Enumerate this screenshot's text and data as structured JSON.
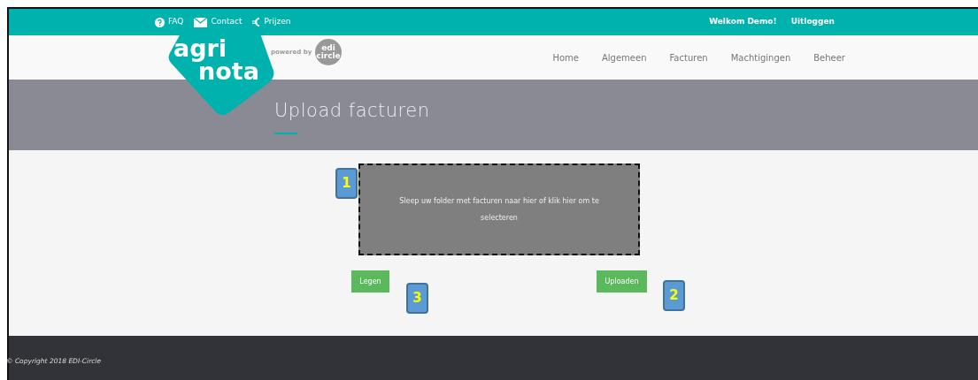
{
  "top_bar": {
    "links": [
      {
        "label": "FAQ"
      },
      {
        "label": "Contact"
      },
      {
        "label": "Prijzen"
      }
    ],
    "welcome": "Welkom Demo!",
    "logout": "Uitloggen"
  },
  "logo": {
    "line_1": "agri",
    "line_2": "nota",
    "powered_by": "powered by",
    "partner_line_1": "edi",
    "partner_line_2": "circle"
  },
  "nav": {
    "items": [
      {
        "label": "Home"
      },
      {
        "label": "Algemeen"
      },
      {
        "label": "Facturen"
      },
      {
        "label": "Machtigingen"
      },
      {
        "label": "Beheer"
      }
    ]
  },
  "page_title": "Upload facturen",
  "dropzone": {
    "text": "Sleep uw folder met facturen naar hier of klik hier om te selecteren"
  },
  "buttons": [
    {
      "label": "Legen"
    },
    {
      "label": "Uploaden"
    }
  ],
  "callouts": [
    {
      "label": "1"
    },
    {
      "label": "2"
    },
    {
      "label": "3"
    }
  ],
  "footer": {
    "copyright": "© Copyright 2018 EDI-Circle"
  }
}
